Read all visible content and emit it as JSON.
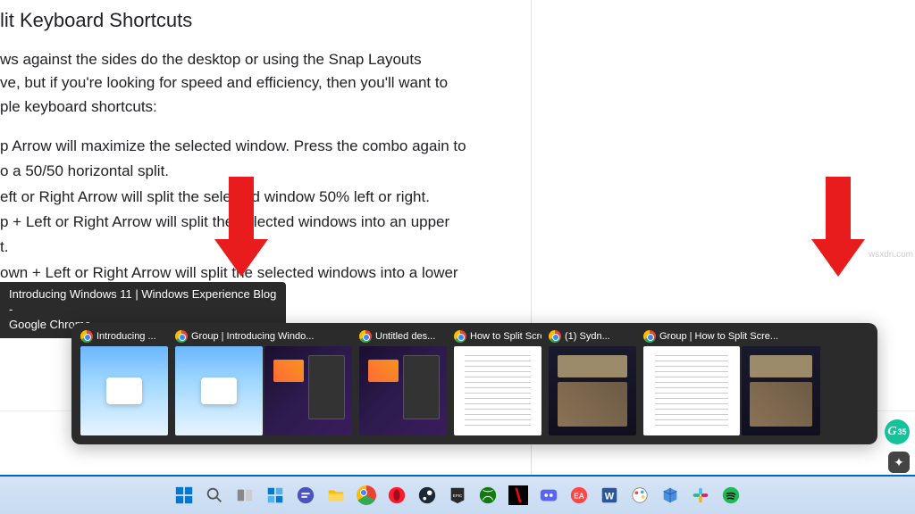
{
  "article": {
    "heading": "lit Keyboard Shortcuts",
    "p1a": "ws against the sides do the desktop or using the Snap Layouts",
    "p1b": "ve, but if you're looking for speed and efficiency, then you'll want to",
    "p1c": "ple keyboard shortcuts:",
    "li1a": "p Arrow will maximize the selected window. Press the combo again to",
    "li1b": "o a 50/50 horizontal split.",
    "li2": "eft or Right Arrow will split the selected window 50% left or right.",
    "li3a": "p + Left or Right Arrow will split the selected windows into an upper",
    "li3b": "t.",
    "li4": "own + Left or Right Arrow will split the selected windows into a lower"
  },
  "tooltip": {
    "line1": "Introducing Windows 11 | Windows Experience Blog -",
    "line2": "Google Chrome"
  },
  "taskview": {
    "items": [
      {
        "label": "Introducing ...",
        "layout": "single",
        "panes": [
          "win11"
        ]
      },
      {
        "label": "Group | Introducing Windo...",
        "layout": "double",
        "panes": [
          "win11",
          "dark"
        ]
      },
      {
        "label": "Untitled des...",
        "layout": "single",
        "panes": [
          "dark"
        ]
      },
      {
        "label": "How to Split Scree...",
        "layout": "single",
        "panes": [
          "doc"
        ]
      },
      {
        "label": "(1) Sydn...",
        "layout": "single",
        "panes": [
          "darkdoc"
        ]
      },
      {
        "label": "Group | How to Split Scre...",
        "layout": "double",
        "panes": [
          "doc",
          "darkdoc"
        ]
      }
    ]
  },
  "taskbar": {
    "icons": [
      "start",
      "search",
      "taskview",
      "widgets",
      "chat",
      "explorer",
      "chrome",
      "opera",
      "steam",
      "epic",
      "xbox",
      "netflix",
      "discord",
      "ea",
      "word",
      "paint",
      "3d",
      "slack",
      "spotify"
    ]
  },
  "badge": {
    "count": "35"
  },
  "watermark": "wsxdn.com",
  "colors": {
    "arrow": "#e81c1c",
    "taskview_bg": "#2b2b2b",
    "taskbar_accent": "#0067c0"
  }
}
